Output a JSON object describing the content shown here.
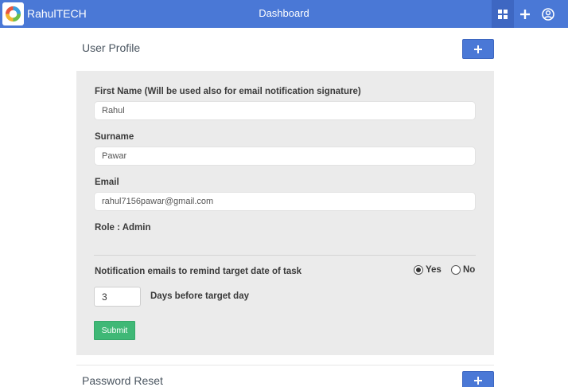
{
  "topbar": {
    "brand": "RahulTECH",
    "title": "Dashboard",
    "icons": [
      "dashboard-icon",
      "plus-icon",
      "user-circle-icon"
    ],
    "color": "#4a78d6"
  },
  "profile": {
    "title": "User Profile",
    "first_name_label": "First Name (Will be used also for email notification signature)",
    "first_name_value": "Rahul",
    "surname_label": "Surname",
    "surname_value": "Pawar",
    "email_label": "Email",
    "email_value": "rahul7156pawar@gmail.com",
    "role_text": "Role : Admin",
    "notification_label": "Notification emails to remind target date of task",
    "notification_yes": "Yes",
    "notification_no": "No",
    "notification_selected": "Yes",
    "days_value": "3",
    "days_label": "Days before target day",
    "submit_label": "Submit"
  },
  "password": {
    "title": "Password Reset"
  }
}
